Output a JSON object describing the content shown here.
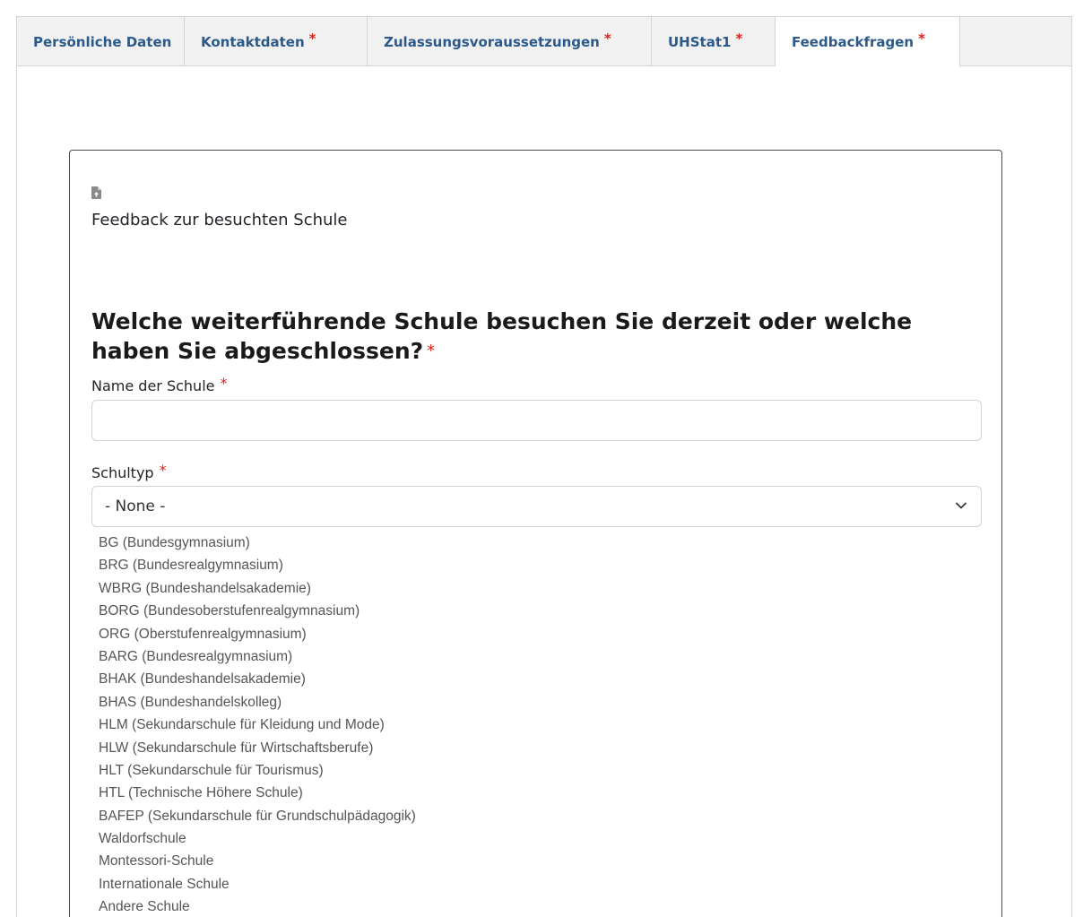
{
  "tabs": [
    {
      "label": "Persönliche Daten",
      "required": false,
      "active": false
    },
    {
      "label": "Kontaktdaten",
      "required": true,
      "active": false
    },
    {
      "label": "Zulassungsvoraussetzungen",
      "required": true,
      "active": false
    },
    {
      "label": "UHStat1",
      "required": true,
      "active": false
    },
    {
      "label": "Feedbackfragen",
      "required": true,
      "active": true
    }
  ],
  "required_marker": "*",
  "section": {
    "icon": "file-icon",
    "title": "Feedback zur besuchten Schule"
  },
  "question": {
    "text": "Welche weiterführende Schule besuchen Sie derzeit oder welche haben Sie abgeschlossen?"
  },
  "fields": {
    "school_name": {
      "label": "Name der Schule",
      "value": ""
    },
    "school_type": {
      "label": "Schultyp",
      "selected": "- None -",
      "options": [
        "BG (Bundesgymnasium)",
        "BRG (Bundesrealgymnasium)",
        "WBRG (Bundeshandelsakademie)",
        "BORG (Bundesoberstufenrealgymnasium)",
        "ORG (Oberstufenrealgymnasium)",
        "BARG (Bundesrealgymnasium)",
        "BHAK (Bundeshandelsakademie)",
        "BHAS (Bundeshandelskolleg)",
        "HLM (Sekundarschule für Kleidung und Mode)",
        "HLW (Sekundarschule für Wirtschaftsberufe)",
        "HLT (Sekundarschule für Tourismus)",
        "HTL (Technische Höhere Schule)",
        "BAFEP (Sekundarschule für Grundschulpädagogik)",
        "Waldorfschule",
        "Montessori-Schule",
        "Internationale Schule",
        "Andere Schule"
      ]
    }
  },
  "colors": {
    "tab_text": "#2b5a8a",
    "required": "#e0201b",
    "tab_bar": "#f1f1f1"
  }
}
